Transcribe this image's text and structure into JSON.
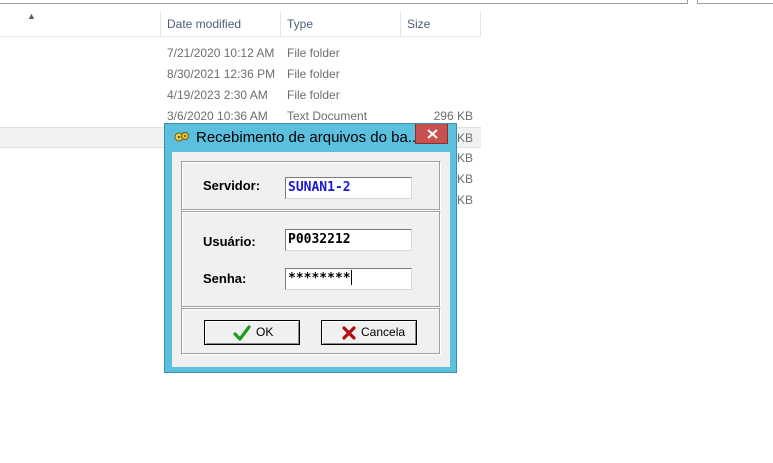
{
  "explorer": {
    "columns": {
      "date": "Date modified",
      "type": "Type",
      "size": "Size"
    },
    "rows": [
      {
        "date": "7/21/2020 10:12 AM",
        "type": "File folder",
        "size": ""
      },
      {
        "date": "8/30/2021 12:36 PM",
        "type": "File folder",
        "size": ""
      },
      {
        "date": "4/19/2023 2:30 AM",
        "type": "File folder",
        "size": ""
      },
      {
        "date": "3/6/2020 10:36 AM",
        "type": "Text Document",
        "size": "296 KB"
      },
      {
        "date": "",
        "type": "",
        "size": "KB"
      },
      {
        "date": "",
        "type": "",
        "size": "KB"
      },
      {
        "date": "",
        "type": "",
        "size": "KB"
      },
      {
        "date": "",
        "type": "",
        "size": "KB"
      }
    ]
  },
  "dialog": {
    "title": "Recebimento de arquivos do ba...",
    "server_label": "Servidor:",
    "server_value": "SUNAN1-2",
    "user_label": "Usuário:",
    "user_value": "P0032212",
    "password_label": "Senha:",
    "password_value": "********",
    "ok_label": "OK",
    "cancel_label": "Cancela"
  },
  "colors": {
    "dialog_frame": "#5bc0de",
    "close_button": "#c75050",
    "server_text": "#1a1ad0"
  }
}
